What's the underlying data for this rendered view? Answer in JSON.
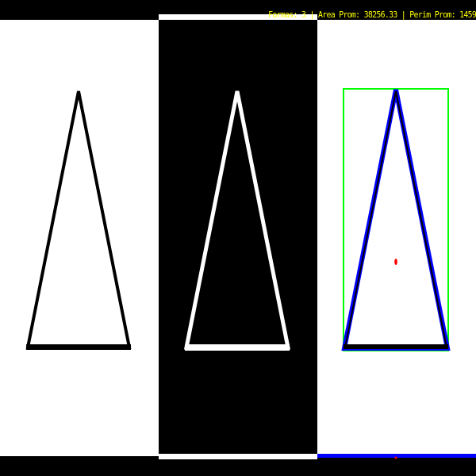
{
  "stats": {
    "text": "Formas: 3 | Area Prom: 38256.33 | Perim Prom: 1459"
  },
  "colors": {
    "background": "#ffffff",
    "outline": "#000000",
    "inverted_fill": "#000000",
    "inverted_outline": "#ffffff",
    "contour": "#0000ff",
    "bounding_box": "#00ff00",
    "centroid": "#ff0000",
    "stats_text": "#ffff00"
  },
  "panels": [
    {
      "name": "original"
    },
    {
      "name": "binary"
    },
    {
      "name": "analysis"
    }
  ]
}
